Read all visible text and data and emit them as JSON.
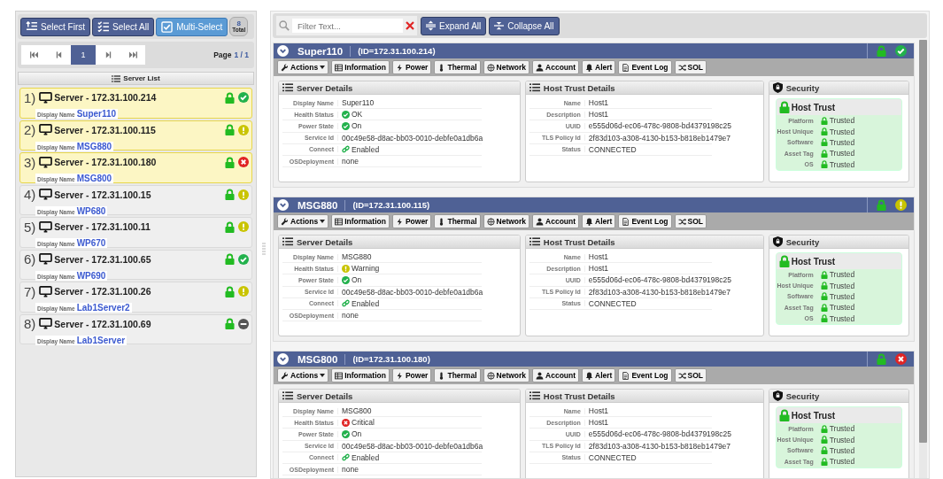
{
  "left_toolbar": {
    "buttons": [
      {
        "label": "Select First",
        "kind": "button"
      },
      {
        "label": "Select All",
        "kind": "button"
      },
      {
        "label": "Multi-Select",
        "kind": "toggle",
        "checked": true
      }
    ],
    "total": {
      "count": "8",
      "label": "Total"
    }
  },
  "pager": {
    "pages": [
      {
        "label": "1",
        "selected": true
      }
    ],
    "page_label": "Page",
    "page_value": "1 / 1"
  },
  "server_list": {
    "title": "Server List",
    "items": [
      {
        "index": "1)",
        "title": "Server - 172.31.100.214",
        "display_label": "Display Name",
        "display_name": "Super110",
        "selected": true,
        "locked": true,
        "kind": "ok"
      },
      {
        "index": "2)",
        "title": "Server - 172.31.100.115",
        "display_label": "Display Name",
        "display_name": "MSG880",
        "selected": true,
        "locked": true,
        "kind": "warning"
      },
      {
        "index": "3)",
        "title": "Server - 172.31.100.180",
        "display_label": "Display Name",
        "display_name": "MSG800",
        "selected": true,
        "locked": true,
        "kind": "critical"
      },
      {
        "index": "4)",
        "title": "Server - 172.31.100.15",
        "display_label": "Display Name",
        "display_name": "WP680",
        "selected": false,
        "locked": true,
        "kind": "warning"
      },
      {
        "index": "5)",
        "title": "Server - 172.31.100.11",
        "display_label": "Display Name",
        "display_name": "WP670",
        "selected": false,
        "locked": true,
        "kind": "warning"
      },
      {
        "index": "6)",
        "title": "Server - 172.31.100.65",
        "display_label": "Display Name",
        "display_name": "WP690",
        "selected": false,
        "locked": true,
        "kind": "ok"
      },
      {
        "index": "7)",
        "title": "Server - 172.31.100.26",
        "display_label": "Display Name",
        "display_name": "Lab1Server2",
        "selected": false,
        "locked": true,
        "kind": "warning"
      },
      {
        "index": "8)",
        "title": "Server - 172.31.100.69",
        "display_label": "Display Name",
        "display_name": "Lab1Server",
        "selected": false,
        "locked": true,
        "kind": "unknown"
      }
    ]
  },
  "filter": {
    "placeholder": "Filter Text..."
  },
  "actions": [
    "Expand All",
    "Collapse All"
  ],
  "servers": [
    {
      "name": "Super110",
      "id": "(ID=172.31.100.214)",
      "expanded": true,
      "locked": true,
      "kind": "ok",
      "tools": [
        {
          "label": "Actions",
          "kind": "menu"
        },
        {
          "label": "Information",
          "kind": "button"
        },
        {
          "label": "Power",
          "kind": "button"
        },
        {
          "label": "Thermal",
          "kind": "button"
        },
        {
          "label": "Network",
          "kind": "button"
        },
        {
          "label": "Account",
          "kind": "button"
        },
        {
          "label": "Alert",
          "kind": "button"
        },
        {
          "label": "Event Log",
          "kind": "button"
        },
        {
          "label": "SOL",
          "kind": "button"
        }
      ],
      "server_details": {
        "title": "Server Details",
        "rows": [
          {
            "label": "Display Name",
            "value": "Super110"
          },
          {
            "label": "Health Status",
            "value": "OK",
            "kind": "ok"
          },
          {
            "label": "Power State",
            "value": "On",
            "kind": "ok"
          },
          {
            "label": "Service Id",
            "value": "00c49e58-d8ac-bb03-0010-debfe0a1db6a"
          },
          {
            "label": "Connect",
            "value": "Enabled",
            "kind": "link"
          },
          {
            "label": "OSDeployment",
            "value": "none"
          }
        ]
      },
      "host_trust": {
        "title": "Host Trust Details",
        "rows": [
          {
            "label": "Name",
            "value": "Host1"
          },
          {
            "label": "Description",
            "value": "Host1"
          },
          {
            "label": "UUID",
            "value": "e555d06d-ec06-478c-9808-bd4379198c25"
          },
          {
            "label": "TLS Policy Id",
            "value": "2f83d103-a308-4130-b153-b818eb1479e7"
          },
          {
            "label": "Status",
            "value": "CONNECTED"
          }
        ]
      },
      "security": {
        "title": "Security",
        "heading": "Host Trust",
        "locked": true,
        "rows": [
          {
            "label": "Platform",
            "value": "Trusted",
            "locked": true
          },
          {
            "label": "Host Unique",
            "value": "Trusted",
            "locked": true
          },
          {
            "label": "Software",
            "value": "Trusted",
            "locked": true
          },
          {
            "label": "Asset Tag",
            "value": "Trusted",
            "locked": true
          },
          {
            "label": "OS",
            "value": "Trusted",
            "locked": true
          }
        ]
      }
    },
    {
      "name": "MSG880",
      "id": "(ID=172.31.100.115)",
      "expanded": true,
      "locked": true,
      "kind": "warning",
      "tools": [
        {
          "label": "Actions",
          "kind": "menu"
        },
        {
          "label": "Information",
          "kind": "button"
        },
        {
          "label": "Power",
          "kind": "button"
        },
        {
          "label": "Thermal",
          "kind": "button"
        },
        {
          "label": "Network",
          "kind": "button"
        },
        {
          "label": "Account",
          "kind": "button"
        },
        {
          "label": "Alert",
          "kind": "button"
        },
        {
          "label": "Event Log",
          "kind": "button"
        },
        {
          "label": "SOL",
          "kind": "button"
        }
      ],
      "server_details": {
        "title": "Server Details",
        "rows": [
          {
            "label": "Display Name",
            "value": "MSG880"
          },
          {
            "label": "Health Status",
            "value": "Warning",
            "kind": "warning"
          },
          {
            "label": "Power State",
            "value": "On",
            "kind": "ok"
          },
          {
            "label": "Service Id",
            "value": "00c49e58-d8ac-bb03-0010-debfe0a1db6a"
          },
          {
            "label": "Connect",
            "value": "Enabled",
            "kind": "link"
          },
          {
            "label": "OSDeployment",
            "value": "none"
          }
        ]
      },
      "host_trust": {
        "title": "Host Trust Details",
        "rows": [
          {
            "label": "Name",
            "value": "Host1"
          },
          {
            "label": "Description",
            "value": "Host1"
          },
          {
            "label": "UUID",
            "value": "e555d06d-ec06-478c-9808-bd4379198c25"
          },
          {
            "label": "TLS Policy Id",
            "value": "2f83d103-a308-4130-b153-b818eb1479e7"
          },
          {
            "label": "Status",
            "value": "CONNECTED"
          }
        ]
      },
      "security": {
        "title": "Security",
        "heading": "Host Trust",
        "locked": true,
        "rows": [
          {
            "label": "Platform",
            "value": "Trusted",
            "locked": true
          },
          {
            "label": "Host Unique",
            "value": "Trusted",
            "locked": true
          },
          {
            "label": "Software",
            "value": "Trusted",
            "locked": true
          },
          {
            "label": "Asset Tag",
            "value": "Trusted",
            "locked": true
          },
          {
            "label": "OS",
            "value": "Trusted",
            "locked": true
          }
        ]
      }
    },
    {
      "name": "MSG800",
      "id": "(ID=172.31.100.180)",
      "expanded": true,
      "locked": true,
      "kind": "critical",
      "tools": [
        {
          "label": "Actions",
          "kind": "menu"
        },
        {
          "label": "Information",
          "kind": "button"
        },
        {
          "label": "Power",
          "kind": "button"
        },
        {
          "label": "Thermal",
          "kind": "button"
        },
        {
          "label": "Network",
          "kind": "button"
        },
        {
          "label": "Account",
          "kind": "button"
        },
        {
          "label": "Alert",
          "kind": "button"
        },
        {
          "label": "Event Log",
          "kind": "button"
        },
        {
          "label": "SOL",
          "kind": "button"
        }
      ],
      "server_details": {
        "title": "Server Details",
        "rows": [
          {
            "label": "Display Name",
            "value": "MSG800"
          },
          {
            "label": "Health Status",
            "value": "Critical",
            "kind": "critical"
          },
          {
            "label": "Power State",
            "value": "On",
            "kind": "ok"
          },
          {
            "label": "Service Id",
            "value": "00c49e58-d8ac-bb03-0010-debfe0a1db6a"
          },
          {
            "label": "Connect",
            "value": "Enabled",
            "kind": "link"
          },
          {
            "label": "OSDeployment",
            "value": "none"
          }
        ]
      },
      "host_trust": {
        "title": "Host Trust Details",
        "rows": [
          {
            "label": "Name",
            "value": "Host1"
          },
          {
            "label": "Description",
            "value": "Host1"
          },
          {
            "label": "UUID",
            "value": "e555d06d-ec06-478c-9808-bd4379198c25"
          },
          {
            "label": "TLS Policy Id",
            "value": "2f83d103-a308-4130-b153-b818eb1479e7"
          },
          {
            "label": "Status",
            "value": "CONNECTED"
          }
        ]
      },
      "security": {
        "title": "Security",
        "heading": "Host Trust",
        "locked": true,
        "rows": [
          {
            "label": "Platform",
            "value": "Trusted",
            "locked": true
          },
          {
            "label": "Host Unique",
            "value": "Trusted",
            "locked": true
          },
          {
            "label": "Software",
            "value": "Trusted",
            "locked": true
          },
          {
            "label": "Asset Tag",
            "value": "Trusted",
            "locked": true
          }
        ]
      }
    }
  ]
}
